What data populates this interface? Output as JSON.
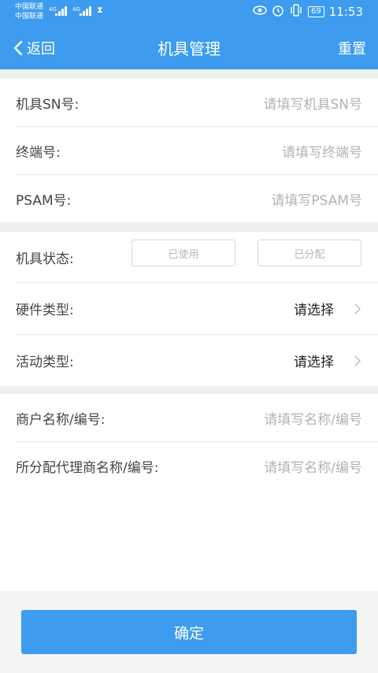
{
  "status_bar": {
    "carrier_1": "中国联通",
    "carrier_2": "中国联通",
    "network_1": "4G",
    "network_2": "4G",
    "battery": "69",
    "time": "11:53",
    "icons": [
      "eye-icon",
      "alarm-icon",
      "vibrate-icon",
      "battery-icon"
    ]
  },
  "nav": {
    "back_label": "返回",
    "title": "机具管理",
    "reset_label": "重置"
  },
  "section1": [
    {
      "label": "机具SN号:",
      "placeholder": "请填写机具SN号"
    },
    {
      "label": "终端号:",
      "placeholder": "请填写终端号"
    },
    {
      "label": "PSAM号:",
      "placeholder": "请填写PSAM号"
    }
  ],
  "section2": {
    "status_label": "机具状态:",
    "status_options": [
      "已使用",
      "已分配"
    ],
    "hardware_label": "硬件类型:",
    "hardware_value": "请选择",
    "activity_label": "活动类型:",
    "activity_value": "请选择"
  },
  "section3": [
    {
      "label": "商户名称/编号:",
      "placeholder": "请填写名称/编号"
    },
    {
      "label": "所分配代理商名称/编号:",
      "placeholder": "请填写名称/编号"
    }
  ],
  "footer": {
    "confirm_label": "确定"
  },
  "colors": {
    "accent": "#3d9cf0",
    "background_gap": "#efefef",
    "placeholder": "#b3b3b3"
  }
}
